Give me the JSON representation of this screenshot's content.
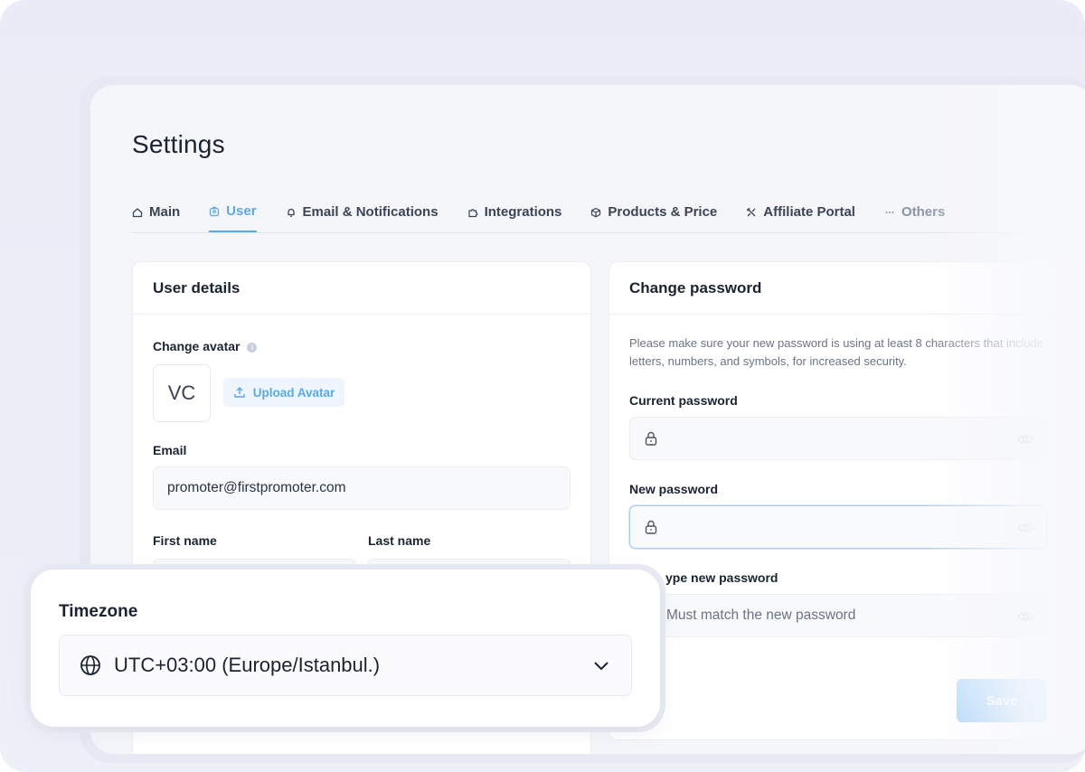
{
  "page": {
    "title": "Settings"
  },
  "tabs": [
    {
      "label": "Main",
      "icon": "home-icon",
      "state": "inactive"
    },
    {
      "label": "User",
      "icon": "user-badge-icon",
      "state": "active"
    },
    {
      "label": "Email & Notifications",
      "icon": "bell-icon",
      "state": "inactive"
    },
    {
      "label": "Integrations",
      "icon": "puzzle-icon",
      "state": "inactive"
    },
    {
      "label": "Products & Price",
      "icon": "box-icon",
      "state": "inactive"
    },
    {
      "label": "Affiliate Portal",
      "icon": "affiliate-icon",
      "state": "inactive"
    },
    {
      "label": "Others",
      "icon": "dots-icon",
      "state": "faded"
    }
  ],
  "user_details": {
    "title": "User details",
    "avatar_label": "Change avatar",
    "avatar_initials": "VC",
    "upload_label": "Upload Avatar",
    "email_label": "Email",
    "email_value": "promoter@firstpromoter.com",
    "first_name_label": "First name",
    "last_name_label": "Last name"
  },
  "change_password": {
    "title": "Change password",
    "hint": "Please make sure your new password is using at least 8 characters that include letters, numbers, and symbols, for increased security.",
    "current_label": "Current password",
    "new_label": "New password",
    "retype_label": "ype new password",
    "retype_placeholder": "Must match the new password",
    "save_label": "Save"
  },
  "timezone": {
    "label": "Timezone",
    "value": "UTC+03:00 (Europe/Istanbul.)"
  },
  "colors": {
    "accent": "#5aa9ea",
    "text": "#1b2333",
    "save_button": "#b6dbf9"
  }
}
